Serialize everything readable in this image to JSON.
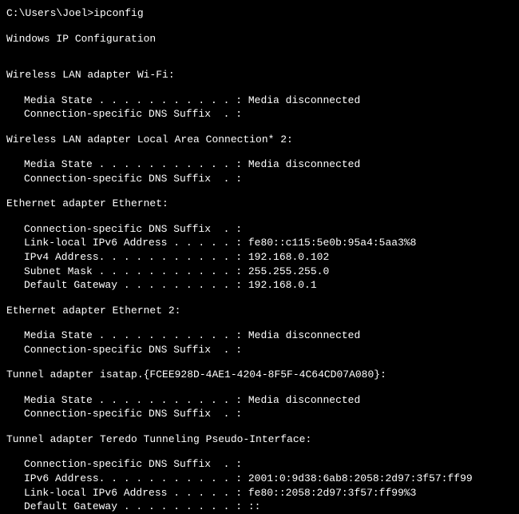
{
  "prompt": "C:\\Users\\Joel>ipconfig",
  "header": "Windows IP Configuration",
  "adapters": [
    {
      "title": "Wireless LAN adapter Wi-Fi:",
      "lines": [
        "Media State . . . . . . . . . . . : Media disconnected",
        "Connection-specific DNS Suffix  . :"
      ]
    },
    {
      "title": "Wireless LAN adapter Local Area Connection* 2:",
      "lines": [
        "Media State . . . . . . . . . . . : Media disconnected",
        "Connection-specific DNS Suffix  . :"
      ]
    },
    {
      "title": "Ethernet adapter Ethernet:",
      "lines": [
        "Connection-specific DNS Suffix  . :",
        "Link-local IPv6 Address . . . . . : fe80::c115:5e0b:95a4:5aa3%8",
        "IPv4 Address. . . . . . . . . . . : 192.168.0.102",
        "Subnet Mask . . . . . . . . . . . : 255.255.255.0",
        "Default Gateway . . . . . . . . . : 192.168.0.1"
      ]
    },
    {
      "title": "Ethernet adapter Ethernet 2:",
      "lines": [
        "Media State . . . . . . . . . . . : Media disconnected",
        "Connection-specific DNS Suffix  . :"
      ]
    },
    {
      "title": "Tunnel adapter isatap.{FCEE928D-4AE1-4204-8F5F-4C64CD07A080}:",
      "lines": [
        "Media State . . . . . . . . . . . : Media disconnected",
        "Connection-specific DNS Suffix  . :"
      ]
    },
    {
      "title": "Tunnel adapter Teredo Tunneling Pseudo-Interface:",
      "lines": [
        "Connection-specific DNS Suffix  . :",
        "IPv6 Address. . . . . . . . . . . : 2001:0:9d38:6ab8:2058:2d97:3f57:ff99",
        "Link-local IPv6 Address . . . . . : fe80::2058:2d97:3f57:ff99%3",
        "Default Gateway . . . . . . . . . : ::"
      ]
    }
  ]
}
